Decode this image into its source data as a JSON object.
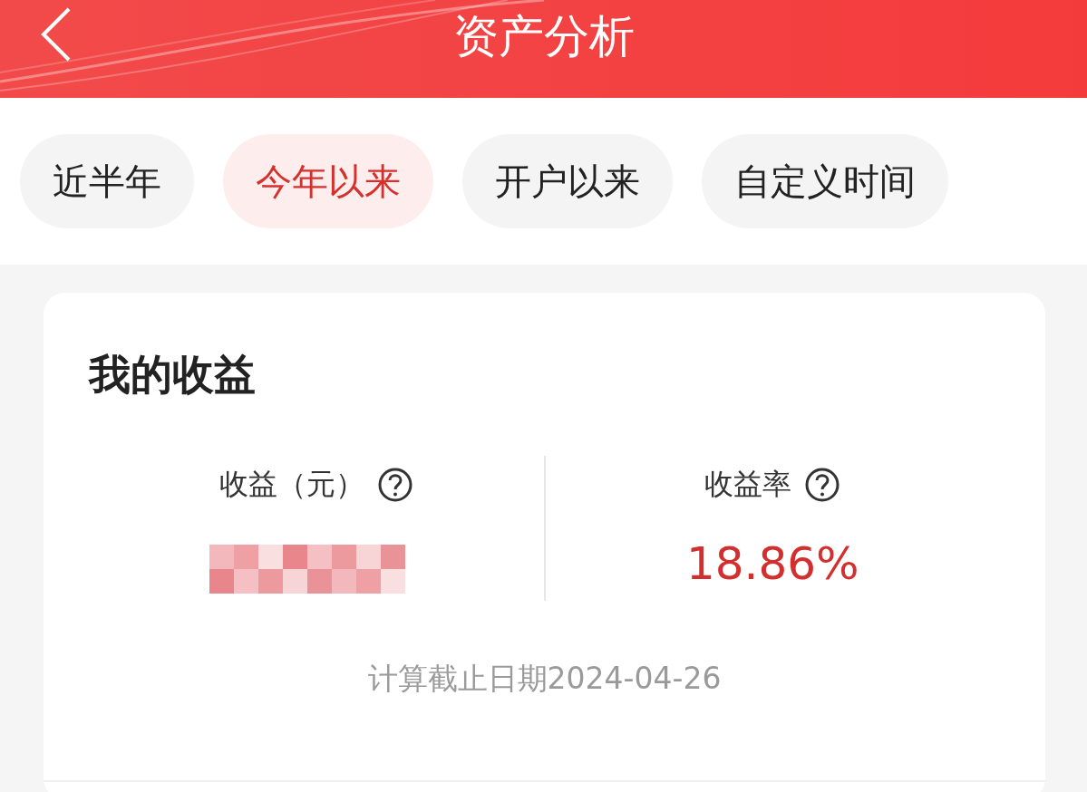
{
  "header": {
    "title": "资产分析"
  },
  "tabs": [
    {
      "label": "近半年",
      "selected": false
    },
    {
      "label": "今年以来",
      "selected": true
    },
    {
      "label": "开户以来",
      "selected": false
    },
    {
      "label": "自定义时间",
      "selected": false
    }
  ],
  "earnings": {
    "title": "我的收益",
    "metrics": [
      {
        "kind": "redacted",
        "label": "收益（元）"
      },
      {
        "kind": "value",
        "label": "收益率",
        "value": "18.86%"
      }
    ],
    "note": "计算截止日期2024-04-26"
  }
}
